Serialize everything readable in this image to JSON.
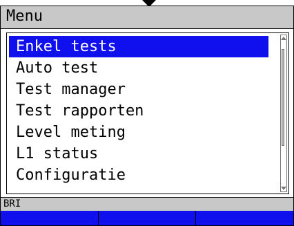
{
  "header": {
    "title": "Menu"
  },
  "menu": {
    "items": [
      {
        "label": "Enkel tests",
        "selected": true
      },
      {
        "label": "Auto test"
      },
      {
        "label": "Test manager"
      },
      {
        "label": "Test rapporten"
      },
      {
        "label": "Level meting"
      },
      {
        "label": "L1 status"
      },
      {
        "label": "Configuratie"
      }
    ]
  },
  "status": {
    "text": "BRI"
  },
  "softkeys": {
    "left": "",
    "middle": "",
    "right": ""
  },
  "colors": {
    "highlight": "#1010ee",
    "bar": "#c8c8c8"
  }
}
